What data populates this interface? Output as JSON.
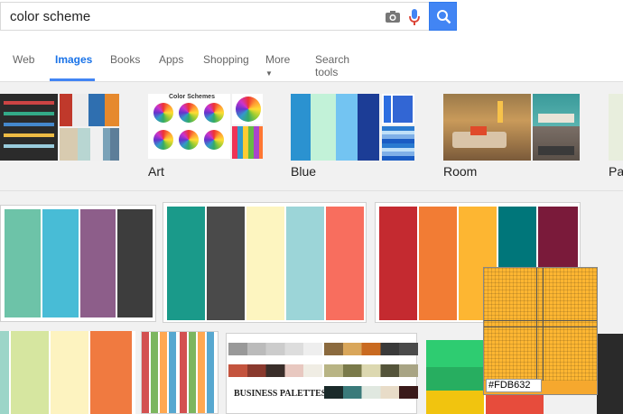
{
  "search": {
    "query": "color scheme"
  },
  "tabs": [
    {
      "label": "Web"
    },
    {
      "label": "Images"
    },
    {
      "label": "Books"
    },
    {
      "label": "Apps"
    },
    {
      "label": "Shopping"
    },
    {
      "label": "More"
    },
    {
      "label": "Search tools"
    }
  ],
  "related": [
    {
      "label": "Art"
    },
    {
      "label": "Blue"
    },
    {
      "label": "Room"
    },
    {
      "label": "Pa"
    }
  ],
  "tiles": {
    "business_palettes": "BUSINESS PALETTES"
  },
  "eyedropper": {
    "hex": "#FDB632",
    "color": "#fdb632"
  },
  "colors": {
    "accent": "#4285f4",
    "tile1": [
      "#6dc3a8",
      "#48bcd6",
      "#8d5e8a",
      "#3d3d3d"
    ],
    "tile2": [
      "#1a9a8a",
      "#4a4a4a",
      "#fdf5c0",
      "#9cd5d8",
      "#f86e5e"
    ],
    "tile3": [
      "#c42a30",
      "#f27c34",
      "#fdb632",
      "#00767a",
      "#7a1a3a"
    ],
    "blue_related": [
      "#2b92d0",
      "#c2f2d8",
      "#73c4f2",
      "#1c3d96",
      "#1c6ad6"
    ]
  }
}
